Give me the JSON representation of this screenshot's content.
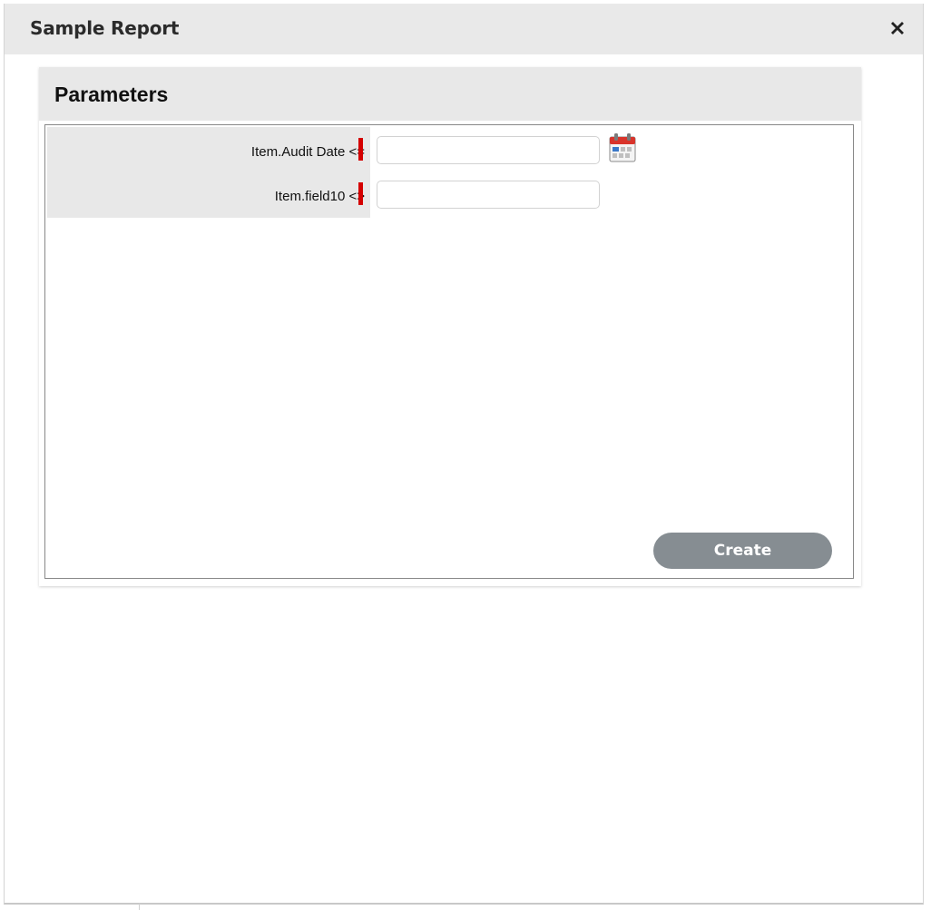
{
  "dialog": {
    "title": "Sample Report",
    "close_icon": "close-icon"
  },
  "panel": {
    "title": "Parameters",
    "fields": [
      {
        "label": "Item.Audit Date <=",
        "value": "",
        "placeholder": "",
        "required": true,
        "icon": "calendar-icon"
      },
      {
        "label": "Item.field10 <>",
        "value": "",
        "placeholder": "",
        "required": true
      }
    ],
    "create_label": "Create"
  },
  "colors": {
    "required_marker": "#d40000",
    "button_bg": "#868d92",
    "header_bg": "#e9e9e9"
  }
}
